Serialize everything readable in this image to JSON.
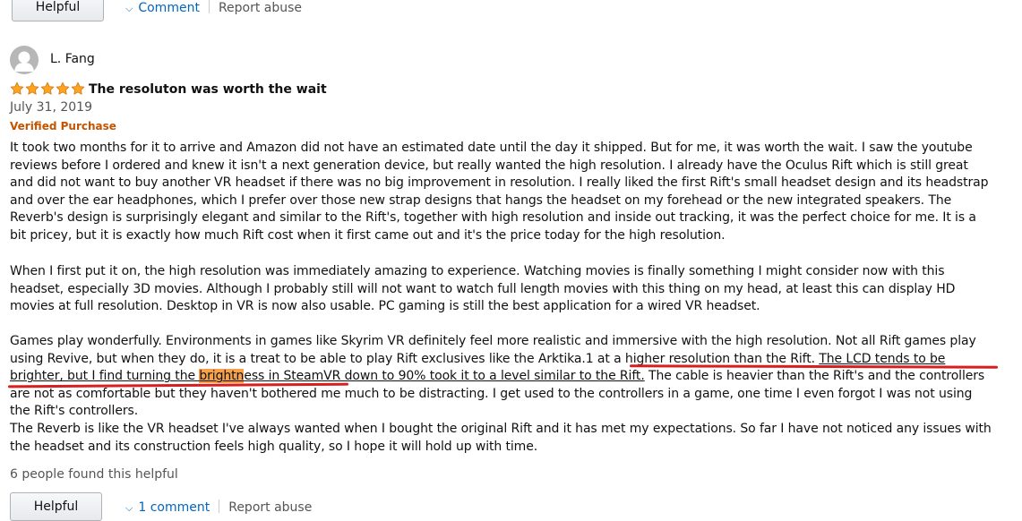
{
  "top_actions": {
    "helpful_label": "Helpful",
    "comment_label": "Comment",
    "report_label": "Report abuse"
  },
  "review": {
    "profile_name": "L. Fang",
    "rating": 5,
    "rating_max": 5,
    "title": "The resoluton was worth the wait",
    "date": "July 31, 2019",
    "verified_label": "Verified Purchase",
    "para1": "It took two months for it to arrive and Amazon did not have an estimated date until the day it shipped. But for me, it was worth the wait. I saw the youtube reviews before I ordered and knew it isn't a next generation device, but really wanted the high resolution. I already have the Oculus Rift which is still great and did not want to buy another VR headset if there was no big improvement in resolution. I really liked the first Rift's small headset design and its headstrap and over the ear headphones, which I prefer over those new strap designs that hangs the headset on my forehead or the new integrated speakers. The Reverb's design is surprisingly elegant and similar to the Rift's, together with high resolution and inside out tracking, it was the perfect choice for me. It is a bit pricey, but it is exactly how much Rift cost when it first came out and it's the price today for the high resolution.",
    "para2": "When I first put it on, the high resolution was immediately amazing to experience. Watching movies is finally something I might consider now with this headset, especially 3D movies. Although I probably still will not want to watch full length movies with this thing on my head, at least this can display HD movies at full resolution. Desktop in VR is now also usable. PC gaming is still the best application for a wired VR headset.",
    "para3_before": "Games play wonderfully. Environments in games like Skyrim VR definitely feel more realistic and immersive with the high resolution. Not all Rift games play using Revive, but when they do, it is a treat to be able to play Rift exclusives like the Arktika.1 at a higher resolution than the Rift. ",
    "para3_ul_a": "The LCD tends to be brighter, but I find turning the ",
    "para3_hl": "brightn",
    "para3_ul_b": "ess in SteamVR down to 90% took it to a level similar to the Rift.",
    "para3_after": " The cable is heavier than the Rift's and the controllers are not as comfortable but they haven't bothered me much to be distracting. I get used to the controllers in a game, one time I even forgot I was not using the Rift's controllers.",
    "para4": "The Reverb is like the VR headset I've always wanted when I bought the original Rift and it has met my expectations. So far I have not noticed any issues with the headset and its construction feels high quality, so I hope it will hold up with time.",
    "helpful_count": "6 people found this helpful"
  },
  "bottom_actions": {
    "helpful_label": "Helpful",
    "comment_label": "1 comment",
    "report_label": "Report abuse"
  },
  "colors": {
    "link": "#0066c0",
    "verified": "#c45500",
    "star": "#ffa41c",
    "highlight": "#f7a24a",
    "annotation_line": "#d81e1e"
  },
  "icons": {
    "avatar": "avatar-silhouette-icon",
    "star": "star-icon",
    "chevron": "chevron-down-icon"
  }
}
